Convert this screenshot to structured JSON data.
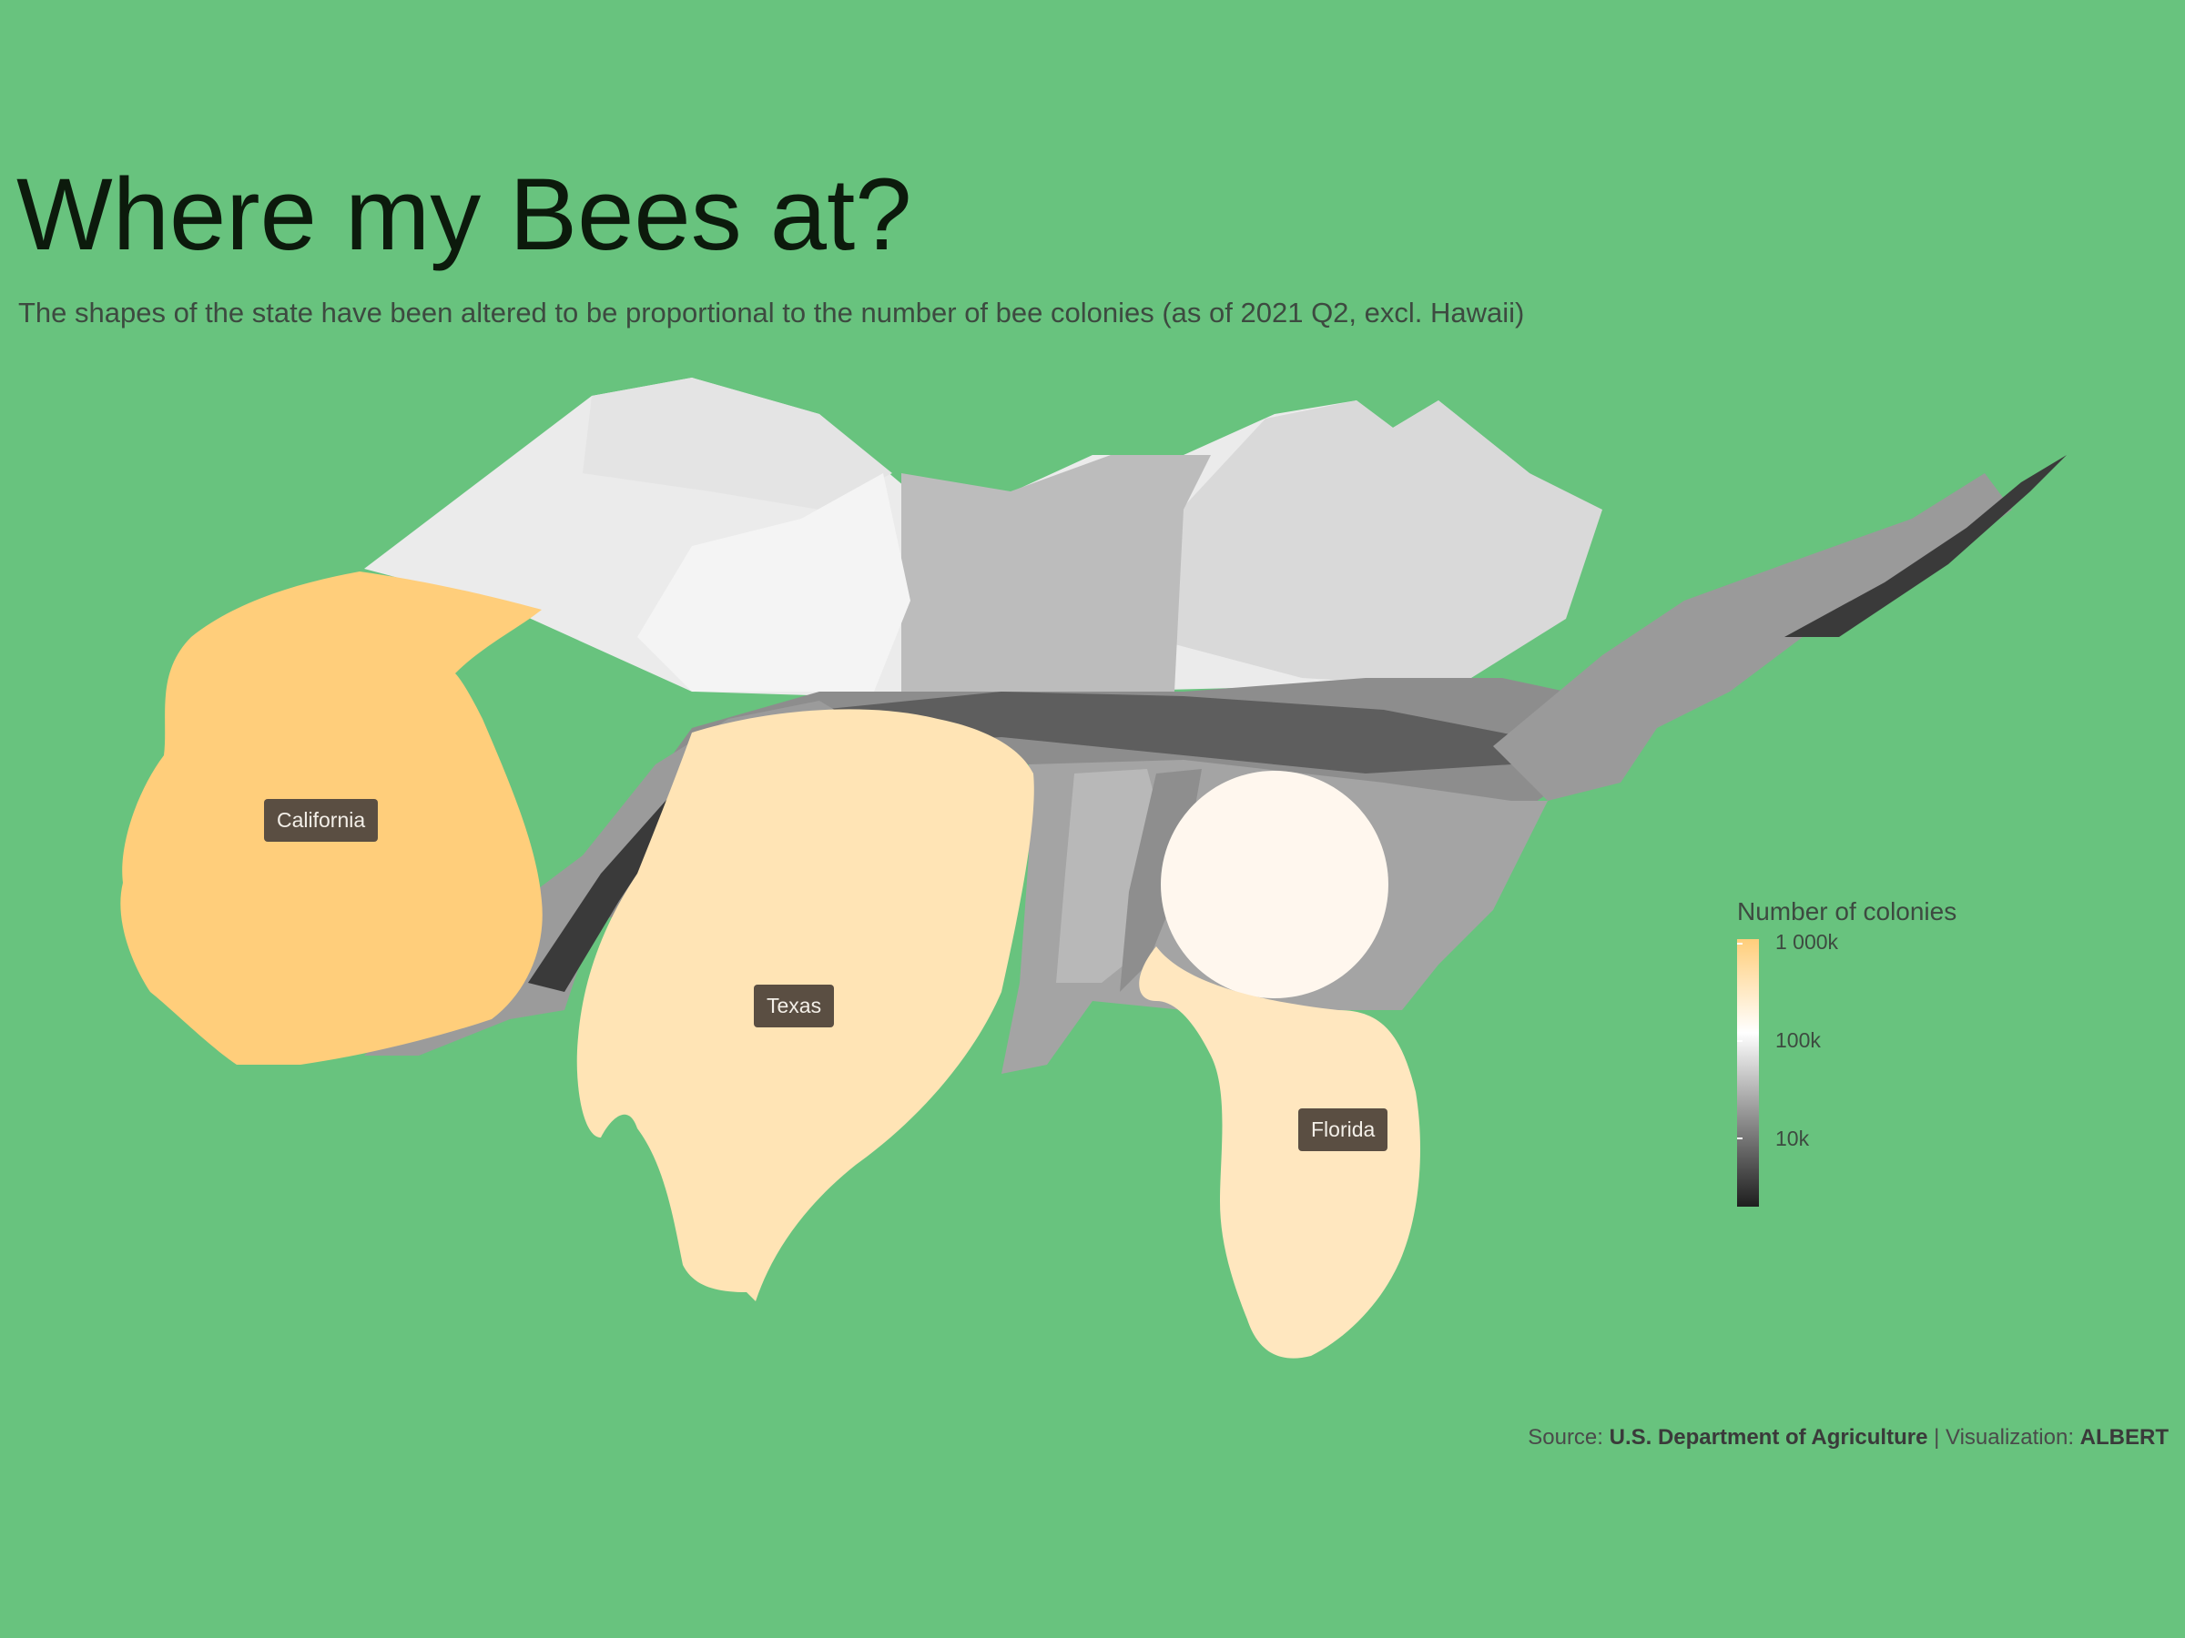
{
  "title": "Where my Bees at?",
  "subtitle": "The shapes of the state have been altered to be proportional to the number of bee colonies (as of 2021 Q2, excl. Hawaii)",
  "map_labels": {
    "california": "California",
    "texas": "Texas",
    "florida": "Florida"
  },
  "legend": {
    "title": "Number of colonies",
    "ticks": [
      "1 000k",
      "100k",
      "10k"
    ],
    "colors": {
      "high": "#ffce7b",
      "mid": "#ffffff",
      "low": "#1e1e1e"
    },
    "scale": "log"
  },
  "caption": {
    "source_prefix": "Source: ",
    "source": "U.S. Department of Agriculture",
    "separator": " | Visualization: ",
    "author": "ALBERT"
  },
  "colors": {
    "background": "#68c37e",
    "california": "#ffce7b",
    "texas": "#ffe4b5",
    "florida": "#ffe7bf",
    "georgia": "#fff7ee"
  }
}
